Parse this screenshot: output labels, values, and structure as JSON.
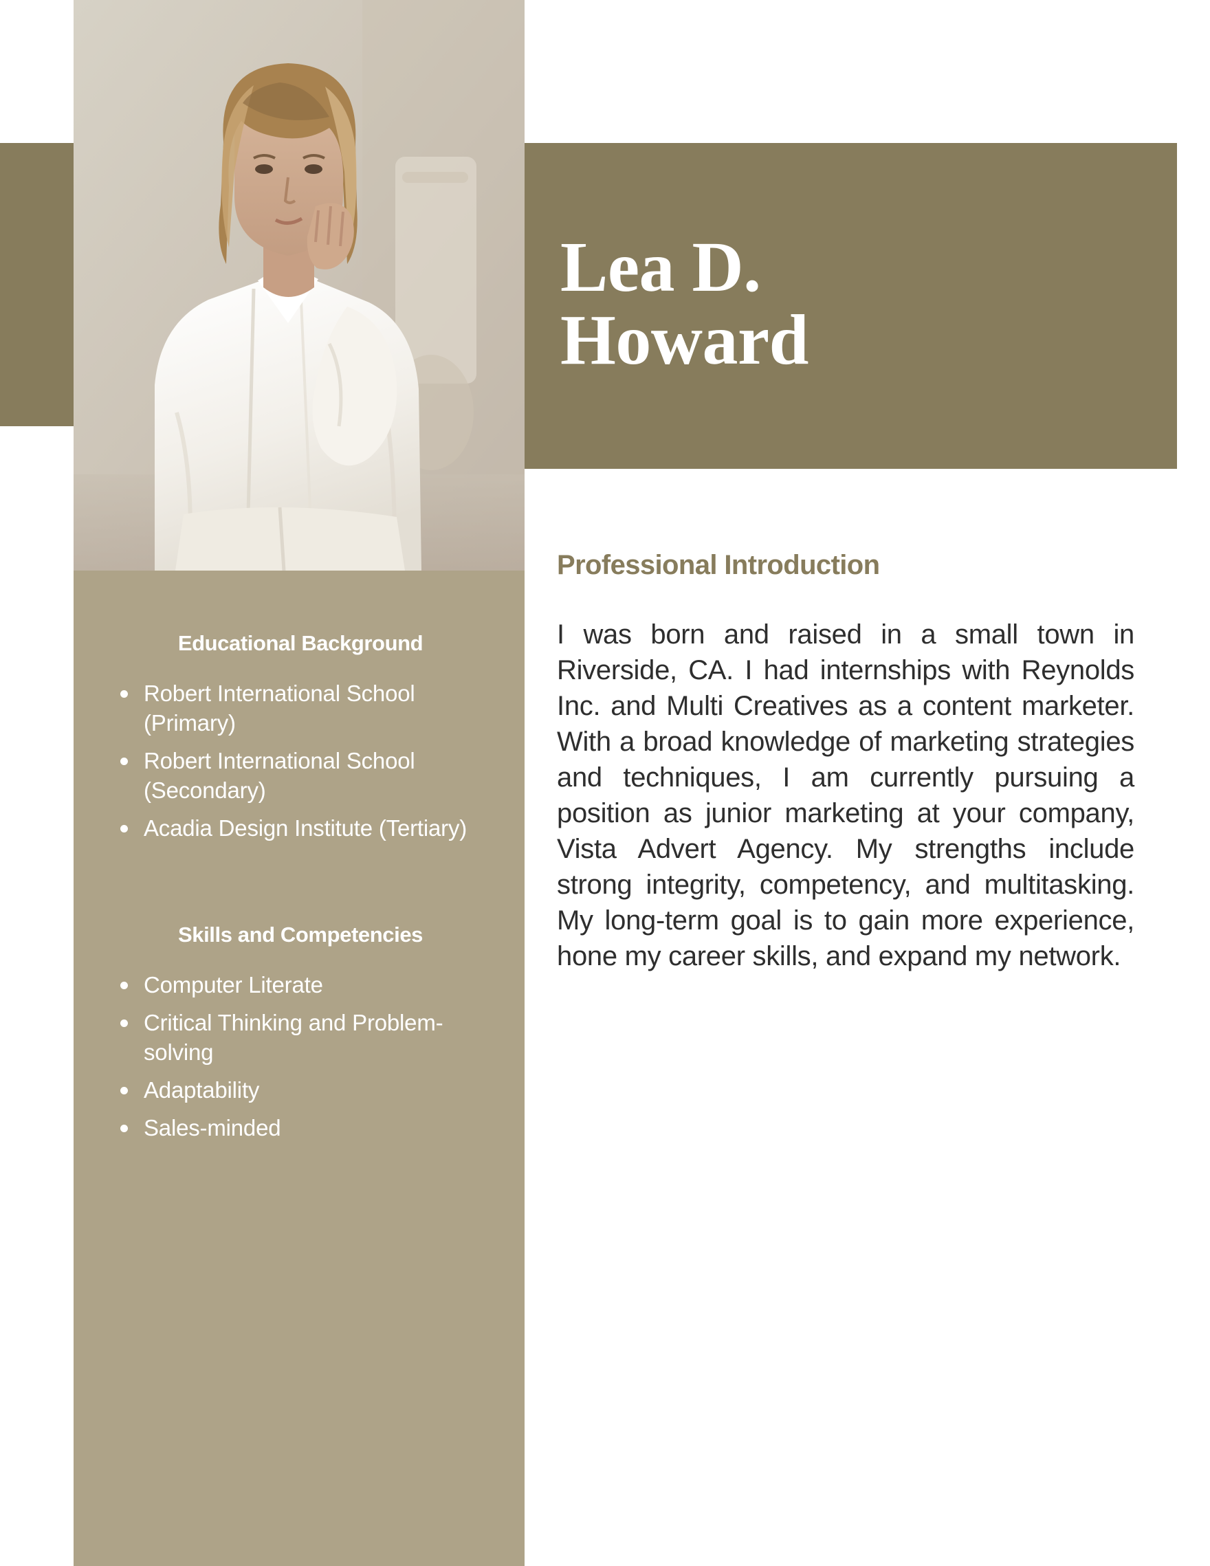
{
  "document": {
    "type": "resume",
    "colors": {
      "accent_dark_olive": "#877c5c",
      "sidebar_khaki": "#aea388",
      "body_text": "#2e2e2e",
      "paper": "#ffffff"
    }
  },
  "header": {
    "name_line1": "Lea D.",
    "name_line2": "Howard"
  },
  "photo": {
    "alt": "portrait-of-woman-in-white-shirt-seated-hand-on-cheek"
  },
  "sidebar": {
    "education": {
      "heading": "Educational Background",
      "items": [
        "Robert International School (Primary)",
        "Robert International School (Secondary)",
        "Acadia Design Institute (Tertiary)"
      ]
    },
    "skills": {
      "heading": "Skills and Competencies",
      "items": [
        "Computer Literate",
        "Critical Thinking and Problem-solving",
        "Adaptability",
        "Sales-minded"
      ]
    }
  },
  "main": {
    "heading": "Professional Introduction",
    "body": "I was born and raised in a small town in Riverside, CA. I had internships with Reynolds Inc. and Multi Creatives as a content marketer. With a broad knowledge of marketing strategies and techniques, I am currently pursuing a position as junior marketing at your company, Vista Advert Agency. My strengths include strong integrity, competency, and multitasking. My long-term goal is to gain more experience, hone my career skills, and expand my network."
  }
}
